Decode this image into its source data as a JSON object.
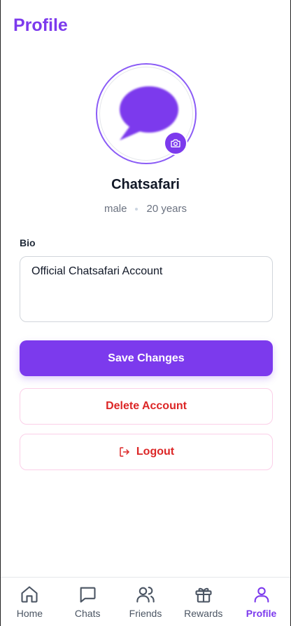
{
  "header": {
    "title": "Profile"
  },
  "profile": {
    "username": "Chatsafari",
    "gender": "male",
    "age": "20 years",
    "avatar_icon": "chat-bubble-icon",
    "camera_icon": "camera-icon"
  },
  "bio": {
    "label": "Bio",
    "value": "Official Chatsafari Account"
  },
  "actions": {
    "save_label": "Save Changes",
    "delete_label": "Delete Account",
    "logout_label": "Logout",
    "logout_icon": "logout-icon"
  },
  "nav": {
    "items": [
      {
        "label": "Home",
        "icon": "home-icon",
        "active": false
      },
      {
        "label": "Chats",
        "icon": "chat-icon",
        "active": false
      },
      {
        "label": "Friends",
        "icon": "users-icon",
        "active": false
      },
      {
        "label": "Rewards",
        "icon": "gift-icon",
        "active": false
      },
      {
        "label": "Profile",
        "icon": "user-icon",
        "active": true
      }
    ]
  },
  "colors": {
    "accent": "#7c3aed",
    "danger": "#dc2626",
    "muted": "#6b7280"
  }
}
